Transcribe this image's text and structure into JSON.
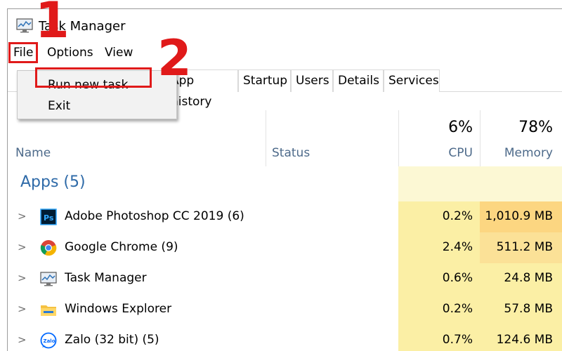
{
  "window": {
    "title": "Task Manager"
  },
  "menu": {
    "items": [
      {
        "label": "File"
      },
      {
        "label": "Options"
      },
      {
        "label": "View"
      }
    ]
  },
  "file_menu": {
    "items": [
      {
        "label": "Run new task"
      },
      {
        "label": "Exit"
      }
    ]
  },
  "tabs": [
    {
      "label": "App history"
    },
    {
      "label": "Startup"
    },
    {
      "label": "Users"
    },
    {
      "label": "Details"
    },
    {
      "label": "Services"
    }
  ],
  "columns": {
    "name": "Name",
    "status": "Status",
    "cpu": {
      "label": "CPU",
      "percent": "6%"
    },
    "memory": {
      "label": "Memory",
      "percent": "78%"
    }
  },
  "group": {
    "label": "Apps (5)"
  },
  "rows": [
    {
      "name": "Adobe Photoshop CC 2019 (6)",
      "cpu": "0.2%",
      "memory": "1,010.9 MB",
      "icon": "photoshop-icon"
    },
    {
      "name": "Google Chrome (9)",
      "cpu": "2.4%",
      "memory": "511.2 MB",
      "icon": "chrome-icon"
    },
    {
      "name": "Task Manager",
      "cpu": "0.6%",
      "memory": "24.8 MB",
      "icon": "task-manager-icon"
    },
    {
      "name": "Windows Explorer",
      "cpu": "0.2%",
      "memory": "57.8 MB",
      "icon": "folder-icon"
    },
    {
      "name": "Zalo (32 bit) (5)",
      "cpu": "0.7%",
      "memory": "124.6 MB",
      "icon": "zalo-icon"
    }
  ],
  "annotations": {
    "step1": "1",
    "step2": "2"
  },
  "colors": {
    "annotation_red": "#e01a1a",
    "group_blue": "#2e6aa8",
    "heat_light": "#fcf8d4",
    "heat_mid": "#fbefa5",
    "heat_strong": "#fcd681"
  }
}
